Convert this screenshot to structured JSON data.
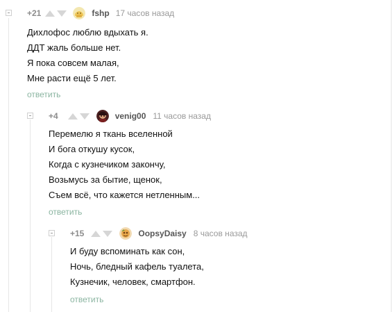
{
  "comments": [
    {
      "rating": "+21",
      "user": "fshp",
      "time": "17 часов назад",
      "lines": [
        "Дихлофос люблю вдыхать я.",
        "ДДТ жаль больше нет.",
        "Я пока совсем малая,",
        "Мне расти ещё 5 лет."
      ],
      "reply_label": "ответить"
    },
    {
      "rating": "+4",
      "user": "venig00",
      "time": "11 часов назад",
      "lines": [
        "Перемелю я ткань вселенной",
        "И бога откушу кусок,",
        "Когда с кузнечиком закончу,",
        "Возьмусь за бытие, щенок,",
        "Съем всё, что кажется нетленным..."
      ],
      "reply_label": "ответить"
    },
    {
      "rating": "+15",
      "user": "OopsyDaisy",
      "time": "8 часов назад",
      "lines": [
        "И буду вспоминать как сон,",
        "Ночь, бледный кафель туалета,",
        "Кузнечик, человек, смартфон."
      ],
      "reply_label": "ответить"
    }
  ],
  "icons": {
    "collapse": "collapse-minus-icon",
    "upvote": "upvote-arrow-icon",
    "downvote": "downvote-arrow-icon"
  }
}
